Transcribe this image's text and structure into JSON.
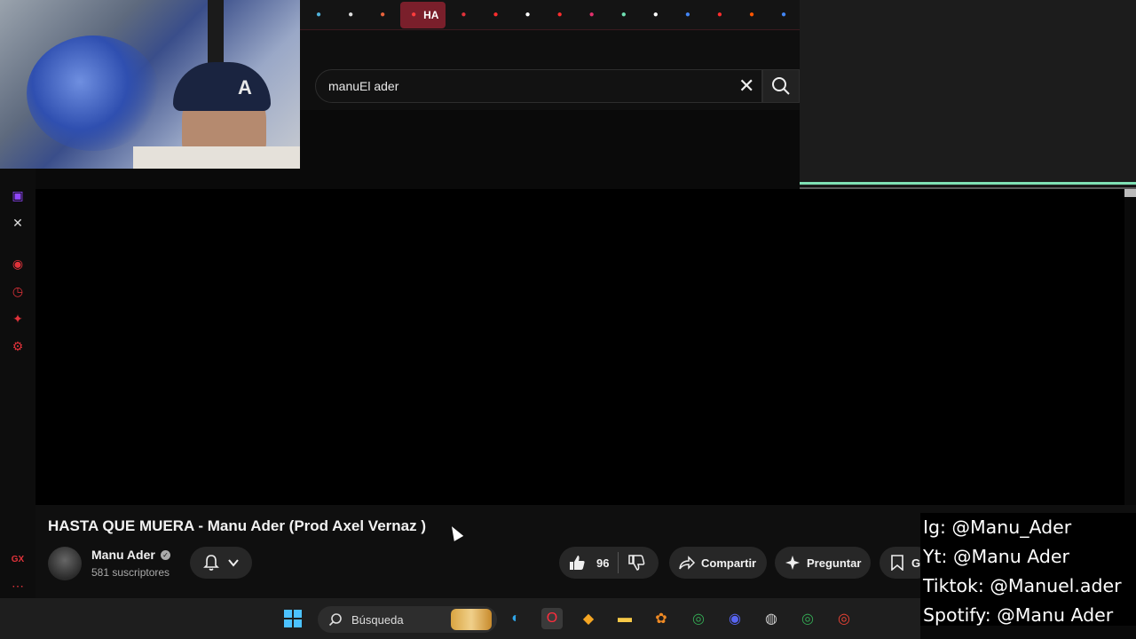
{
  "browser": {
    "tabs": [
      {
        "icon": "map-icon",
        "color": "#4fb0d9"
      },
      {
        "icon": "kick-icon",
        "color": "#dddddd"
      },
      {
        "icon": "orange-circle-icon",
        "color": "#e8623c"
      },
      {
        "icon": "youtube-icon",
        "color": "#ff3d3d",
        "label": "HA",
        "active": true
      },
      {
        "icon": "red-b-icon",
        "color": "#e0323a"
      },
      {
        "icon": "youtube-icon",
        "color": "#ff2d2d"
      },
      {
        "icon": "tiktok-icon",
        "color": "#ffffff"
      },
      {
        "icon": "youtube-icon",
        "color": "#ff2d2d"
      },
      {
        "icon": "instagram-icon",
        "color": "#e1306c"
      },
      {
        "icon": "edit-icon",
        "color": "#6fe0b2"
      },
      {
        "icon": "audio-icon",
        "color": "#ffffff"
      },
      {
        "icon": "google-icon",
        "color": "#4285f4"
      },
      {
        "icon": "youtube-icon",
        "color": "#ff2d2d"
      },
      {
        "icon": "soundcloud-icon",
        "color": "#ff5500"
      },
      {
        "icon": "google-icon",
        "color": "#4285f4"
      }
    ]
  },
  "search": {
    "query": "manuEl ader"
  },
  "video": {
    "title": "HASTA QUE MUERA - Manu Ader (Prod Axel Vernaz )",
    "channel": "Manu Ader",
    "subscribers": "581 suscriptores",
    "likes": "96",
    "share_label": "Compartir",
    "ask_label": "Preguntar",
    "save_label": "Gu"
  },
  "social_overlay": {
    "lines": [
      "Ig: @Manu_Ader",
      "Yt: @Manu Ader",
      "Tiktok: @Manuel.ader",
      "Spotify: @Manu Ader"
    ]
  },
  "taskbar": {
    "search_label": "Búsqueda"
  },
  "colors": {
    "accent": "#7a1f2b",
    "rail_accent": "#e0323a",
    "green_line": "#7fe0b4"
  }
}
